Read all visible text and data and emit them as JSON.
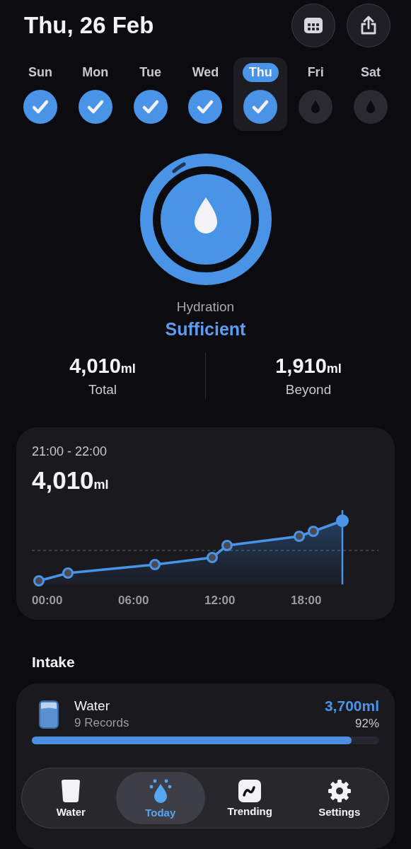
{
  "header": {
    "title": "Thu, 26 Feb"
  },
  "days": [
    {
      "label": "Sun",
      "checked": true,
      "selected": false
    },
    {
      "label": "Mon",
      "checked": true,
      "selected": false
    },
    {
      "label": "Tue",
      "checked": true,
      "selected": false
    },
    {
      "label": "Wed",
      "checked": true,
      "selected": false
    },
    {
      "label": "Thu",
      "checked": true,
      "selected": true
    },
    {
      "label": "Fri",
      "checked": false,
      "selected": false
    },
    {
      "label": "Sat",
      "checked": false,
      "selected": false
    }
  ],
  "hydration": {
    "label": "Hydration",
    "status": "Sufficient"
  },
  "stats": [
    {
      "value": "4,010",
      "unit": "ml",
      "label": "Total"
    },
    {
      "value": "1,910",
      "unit": "ml",
      "label": "Beyond"
    }
  ],
  "chart_card": {
    "range": "21:00 - 22:00",
    "value": "4,010",
    "unit": "ml",
    "x_labels": [
      "00:00",
      "06:00",
      "12:00",
      "18:00"
    ]
  },
  "intake": {
    "title": "Intake",
    "items": [
      {
        "name": "Water",
        "records": "9 Records",
        "amount": "3,700ml",
        "percent": "92%",
        "level": 0.92
      }
    ]
  },
  "tabs": [
    {
      "label": "Water",
      "selected": false
    },
    {
      "label": "Today",
      "selected": true
    },
    {
      "label": "Trending",
      "selected": false
    },
    {
      "label": "Settings",
      "selected": false
    }
  ]
}
